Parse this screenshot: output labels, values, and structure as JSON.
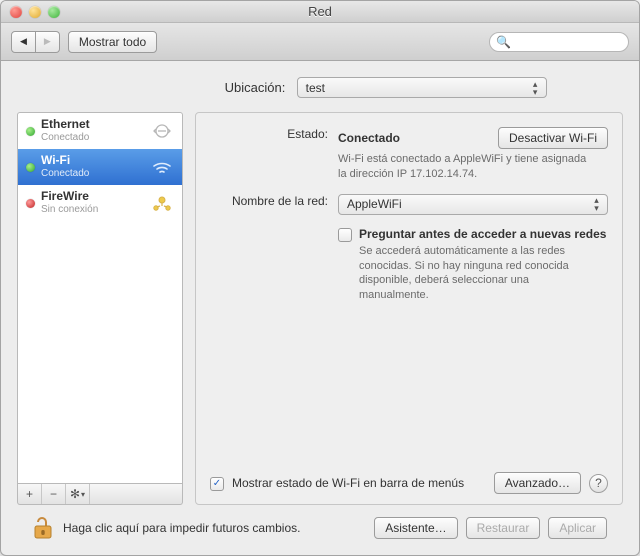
{
  "window": {
    "title": "Red"
  },
  "toolbar": {
    "show_all": "Mostrar todo",
    "search_placeholder": ""
  },
  "location": {
    "label": "Ubicación:",
    "value": "test"
  },
  "interfaces": [
    {
      "name": "Ethernet",
      "sub": "Conectado",
      "status": "green",
      "type": "ethernet",
      "selected": false
    },
    {
      "name": "Wi-Fi",
      "sub": "Conectado",
      "status": "green",
      "type": "wifi",
      "selected": true
    },
    {
      "name": "FireWire",
      "sub": "Sin conexión",
      "status": "red",
      "type": "firewire",
      "selected": false
    }
  ],
  "panel": {
    "status_label": "Estado:",
    "status_value": "Conectado",
    "btn_toggle_wifi": "Desactivar Wi-Fi",
    "status_desc": "Wi-Fi está conectado a AppleWiFi y tiene asignada la dirección IP 17.102.14.74.",
    "network_label": "Nombre de la red:",
    "network_value": "AppleWiFi",
    "ask_join_label": "Preguntar antes de acceder a nuevas redes",
    "ask_join_desc": "Se accederá automáticamente a las redes conocidas. Si no hay ninguna red conocida disponible, deberá seleccionar una manualmente.",
    "ask_join_checked": false,
    "menubar_label": "Mostrar estado de Wi-Fi en barra de menús",
    "menubar_checked": true,
    "advanced_label": "Avanzado…"
  },
  "footer": {
    "lock_hint": "Haga clic aquí para impedir futuros cambios.",
    "assist": "Asistente…",
    "restore": "Restaurar",
    "apply": "Aplicar"
  }
}
